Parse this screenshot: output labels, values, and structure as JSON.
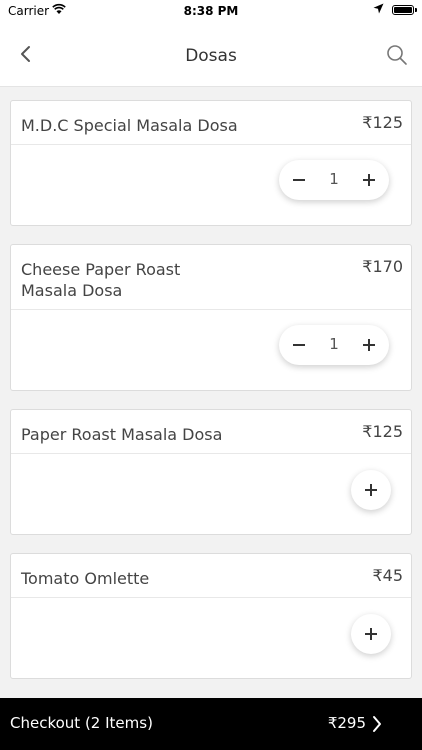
{
  "status_bar": {
    "carrier": "Carrier",
    "time": "8:38 PM"
  },
  "nav": {
    "title": "Dosas",
    "back_icon": "chevron-left-icon",
    "search_icon": "search-icon"
  },
  "items": [
    {
      "name": "M.D.C Special Masala Dosa",
      "price": "₹125",
      "qty": "1"
    },
    {
      "name": "Cheese Paper Roast Masala Dosa",
      "price": "₹170",
      "qty": "1"
    },
    {
      "name": "Paper Roast Masala Dosa",
      "price": "₹125",
      "qty": null
    },
    {
      "name": "Tomato Omlette",
      "price": "₹45",
      "qty": null
    }
  ],
  "checkout": {
    "label": "Checkout (2 Items)",
    "total": "₹295"
  }
}
